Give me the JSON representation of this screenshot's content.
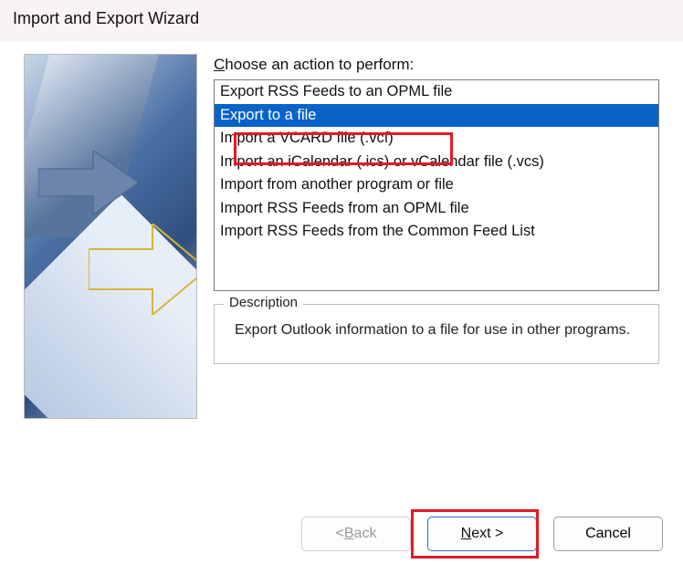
{
  "window": {
    "title": "Import and Export Wizard"
  },
  "prompt": {
    "label_pre": "C",
    "label_post": "hoose an action to perform:"
  },
  "actions": [
    {
      "label": "Export RSS Feeds to an OPML file",
      "selected": false
    },
    {
      "label": "Export to a file",
      "selected": true
    },
    {
      "label": "Import a VCARD file (.vcf)",
      "selected": false
    },
    {
      "label": "Import an iCalendar (.ics) or vCalendar file (.vcs)",
      "selected": false
    },
    {
      "label": "Import from another program or file",
      "selected": false
    },
    {
      "label": "Import RSS Feeds from an OPML file",
      "selected": false
    },
    {
      "label": "Import RSS Feeds from the Common Feed List",
      "selected": false
    }
  ],
  "description": {
    "legend": "Description",
    "text": "Export Outlook information to a file for use in other programs."
  },
  "buttons": {
    "back_pre": "< ",
    "back_u": "B",
    "back_post": "ack",
    "next_u": "N",
    "next_post": "ext >",
    "cancel": "Cancel"
  }
}
